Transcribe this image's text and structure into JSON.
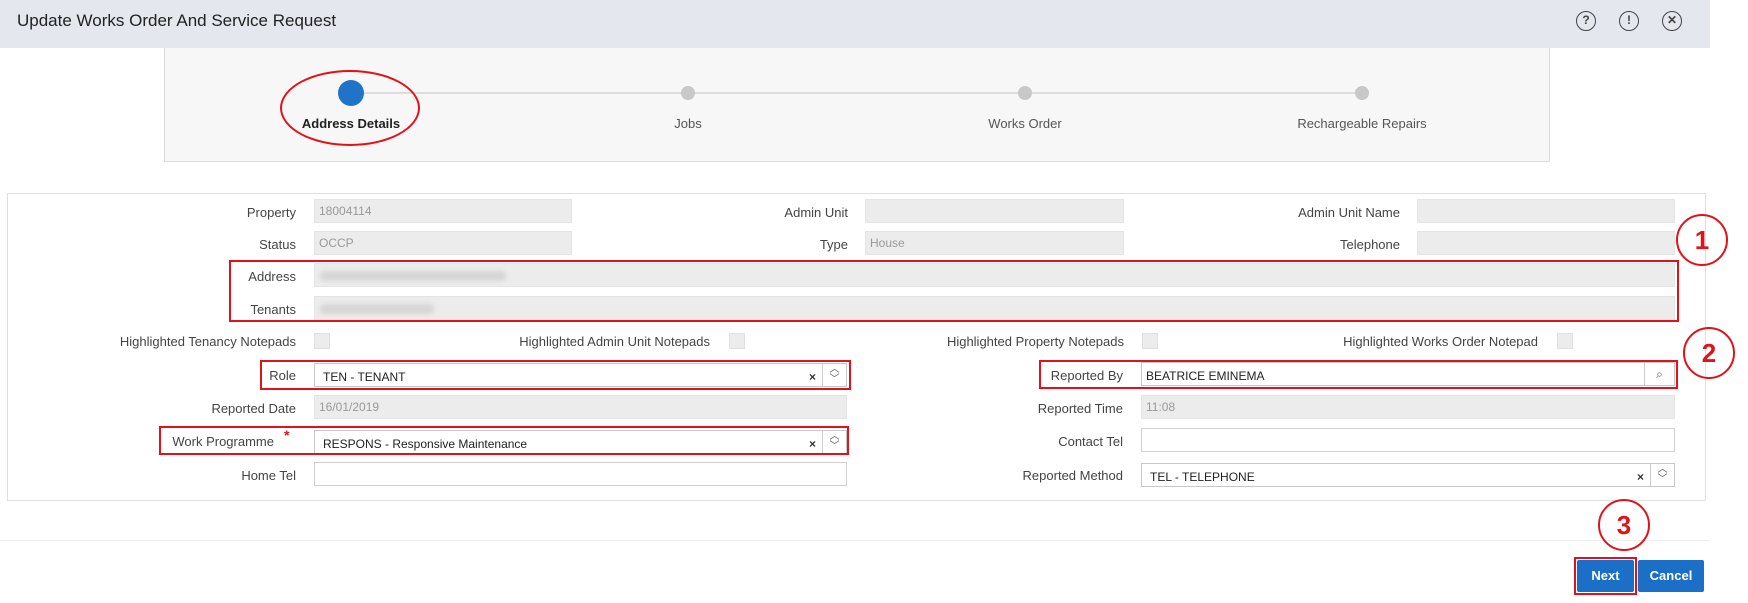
{
  "window": {
    "title": "Update Works Order And Service Request"
  },
  "wizard": {
    "steps": [
      {
        "label": "Address Details"
      },
      {
        "label": "Jobs"
      },
      {
        "label": "Works Order"
      },
      {
        "label": "Rechargeable Repairs"
      }
    ],
    "active_index": 0
  },
  "form": {
    "property": {
      "label": "Property",
      "value": "18004114"
    },
    "admin_unit": {
      "label": "Admin Unit",
      "value": ""
    },
    "admin_unit_name": {
      "label": "Admin Unit Name",
      "value": ""
    },
    "status": {
      "label": "Status",
      "value": "OCCP"
    },
    "type": {
      "label": "Type",
      "value": "House"
    },
    "telephone": {
      "label": "Telephone",
      "value": ""
    },
    "address": {
      "label": "Address"
    },
    "tenants": {
      "label": "Tenants"
    },
    "hl_tenancy": {
      "label": "Highlighted Tenancy Notepads"
    },
    "hl_admin_unit": {
      "label": "Highlighted Admin Unit Notepads"
    },
    "hl_property": {
      "label": "Highlighted Property Notepads"
    },
    "hl_works_order": {
      "label": "Highlighted Works Order Notepad"
    },
    "role": {
      "label": "Role",
      "value": "TEN - TENANT"
    },
    "reported_by": {
      "label": "Reported By",
      "value": "BEATRICE EMINEMA"
    },
    "reported_date": {
      "label": "Reported Date",
      "value": "16/01/2019"
    },
    "reported_time": {
      "label": "Reported Time",
      "value": "11:08"
    },
    "work_programme": {
      "label": "Work Programme",
      "value": "RESPONS - Responsive Maintenance",
      "required_mark": "*"
    },
    "contact_tel": {
      "label": "Contact Tel",
      "value": ""
    },
    "home_tel": {
      "label": "Home Tel",
      "value": ""
    },
    "reported_method": {
      "label": "Reported Method",
      "value": "TEL - TELEPHONE"
    }
  },
  "annotations": {
    "n1": "1",
    "n2": "2",
    "n3": "3"
  },
  "buttons": {
    "next": "Next",
    "cancel": "Cancel"
  },
  "icons": {
    "help": "help-icon",
    "info": "info-icon",
    "close": "close-icon",
    "clear": "×",
    "lookup": "lookup-icon"
  },
  "colors": {
    "accent": "#1b6fc7",
    "annotation": "#e0121a"
  }
}
